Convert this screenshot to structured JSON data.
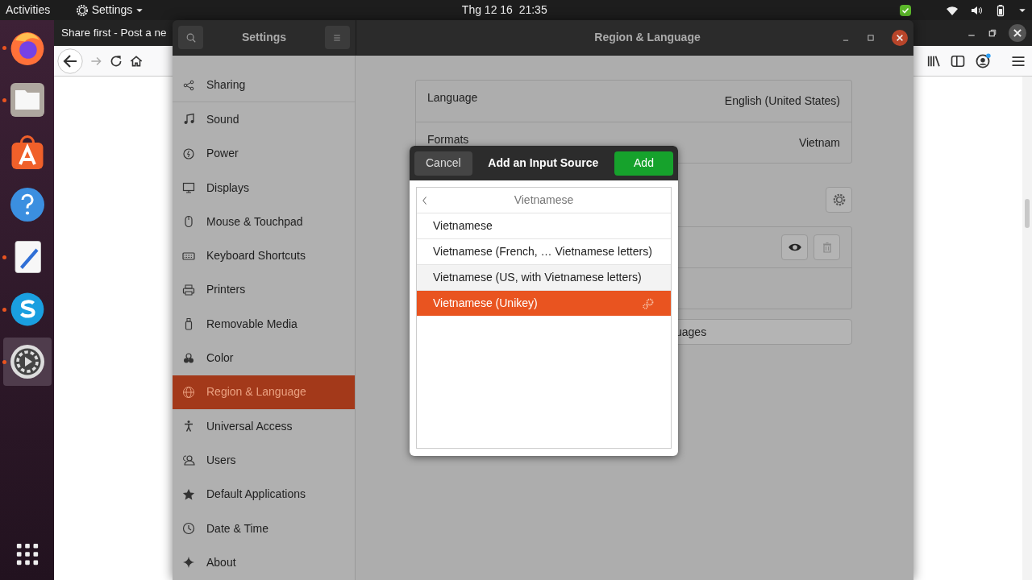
{
  "top_bar": {
    "activities": "Activities",
    "app_menu": "Settings",
    "clock": "Thg 12 16  21:35"
  },
  "dock": [
    {
      "kind": "firefox",
      "running": true,
      "selected": false
    },
    {
      "kind": "files",
      "running": true,
      "selected": false
    },
    {
      "kind": "software",
      "running": false,
      "selected": false
    },
    {
      "kind": "help",
      "running": false,
      "selected": false
    },
    {
      "kind": "editor",
      "running": true,
      "selected": false
    },
    {
      "kind": "skype",
      "running": true,
      "selected": false
    },
    {
      "kind": "settings",
      "running": true,
      "selected": true
    }
  ],
  "browser": {
    "tab_title": "Share first - Post a ne"
  },
  "settings": {
    "title": "Settings",
    "page_title": "Region & Language",
    "sidebar": [
      {
        "label": "Sharing",
        "kind": "share",
        "selected": false
      },
      {
        "label": "Sound",
        "kind": "music",
        "selected": false
      },
      {
        "label": "Power",
        "kind": "power",
        "selected": false
      },
      {
        "label": "Displays",
        "kind": "display",
        "selected": false
      },
      {
        "label": "Mouse & Touchpad",
        "kind": "mouse",
        "selected": false
      },
      {
        "label": "Keyboard Shortcuts",
        "kind": "keyboard",
        "selected": false
      },
      {
        "label": "Printers",
        "kind": "printer",
        "selected": false
      },
      {
        "label": "Removable Media",
        "kind": "usb",
        "selected": false
      },
      {
        "label": "Color",
        "kind": "color",
        "selected": false
      },
      {
        "label": "Region & Language",
        "kind": "globe",
        "selected": true
      },
      {
        "label": "Universal Access",
        "kind": "access",
        "selected": false
      },
      {
        "label": "Users",
        "kind": "users",
        "selected": false
      },
      {
        "label": "Default Applications",
        "kind": "star",
        "selected": false
      },
      {
        "label": "Date & Time",
        "kind": "clock",
        "selected": false
      },
      {
        "label": "About",
        "kind": "sparkle",
        "selected": false
      }
    ],
    "rows": [
      {
        "label": "Language",
        "value": "English (United States)"
      },
      {
        "label": "Formats",
        "value": "Vietnam"
      }
    ],
    "manage_button": "uages"
  },
  "dialog": {
    "cancel": "Cancel",
    "title": "Add an Input Source",
    "add": "Add",
    "search": "Vietnamese",
    "items": [
      {
        "label": "Vietnamese",
        "selected": false,
        "highlighted": false,
        "configurable": false
      },
      {
        "label": "Vietnamese (French, … Vietnamese letters)",
        "selected": false,
        "highlighted": false,
        "configurable": false
      },
      {
        "label": "Vietnamese (US, with Vietnamese letters)",
        "selected": false,
        "highlighted": true,
        "configurable": false
      },
      {
        "label": "Vietnamese (Unikey)",
        "selected": true,
        "highlighted": false,
        "configurable": true
      }
    ]
  }
}
